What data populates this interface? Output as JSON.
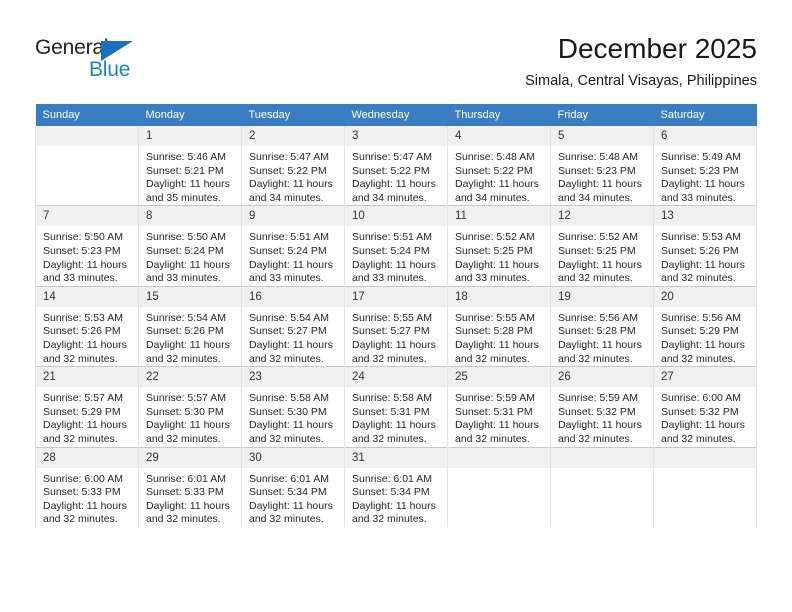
{
  "brand": {
    "name_top": "General",
    "name_bottom": "Blue",
    "accent_color": "#1c84d4",
    "triangle_color": "#1c6fba"
  },
  "header": {
    "title": "December 2025",
    "subtitle": "Simala, Central Visayas, Philippines"
  },
  "calendar": {
    "header_bg": "#3a7ec1",
    "daynum_bg": "#f0f0f0",
    "weekdays": [
      "Sunday",
      "Monday",
      "Tuesday",
      "Wednesday",
      "Thursday",
      "Friday",
      "Saturday"
    ],
    "weeks": [
      [
        {
          "day": "",
          "empty": true,
          "sunrise": "",
          "sunset": "",
          "daylight_line1": "",
          "daylight_line2": ""
        },
        {
          "day": "1",
          "sunrise": "Sunrise: 5:46 AM",
          "sunset": "Sunset: 5:21 PM",
          "daylight_line1": "Daylight: 11 hours",
          "daylight_line2": "and 35 minutes."
        },
        {
          "day": "2",
          "sunrise": "Sunrise: 5:47 AM",
          "sunset": "Sunset: 5:22 PM",
          "daylight_line1": "Daylight: 11 hours",
          "daylight_line2": "and 34 minutes."
        },
        {
          "day": "3",
          "sunrise": "Sunrise: 5:47 AM",
          "sunset": "Sunset: 5:22 PM",
          "daylight_line1": "Daylight: 11 hours",
          "daylight_line2": "and 34 minutes."
        },
        {
          "day": "4",
          "sunrise": "Sunrise: 5:48 AM",
          "sunset": "Sunset: 5:22 PM",
          "daylight_line1": "Daylight: 11 hours",
          "daylight_line2": "and 34 minutes."
        },
        {
          "day": "5",
          "sunrise": "Sunrise: 5:48 AM",
          "sunset": "Sunset: 5:23 PM",
          "daylight_line1": "Daylight: 11 hours",
          "daylight_line2": "and 34 minutes."
        },
        {
          "day": "6",
          "sunrise": "Sunrise: 5:49 AM",
          "sunset": "Sunset: 5:23 PM",
          "daylight_line1": "Daylight: 11 hours",
          "daylight_line2": "and 33 minutes."
        }
      ],
      [
        {
          "day": "7",
          "sunrise": "Sunrise: 5:50 AM",
          "sunset": "Sunset: 5:23 PM",
          "daylight_line1": "Daylight: 11 hours",
          "daylight_line2": "and 33 minutes."
        },
        {
          "day": "8",
          "sunrise": "Sunrise: 5:50 AM",
          "sunset": "Sunset: 5:24 PM",
          "daylight_line1": "Daylight: 11 hours",
          "daylight_line2": "and 33 minutes."
        },
        {
          "day": "9",
          "sunrise": "Sunrise: 5:51 AM",
          "sunset": "Sunset: 5:24 PM",
          "daylight_line1": "Daylight: 11 hours",
          "daylight_line2": "and 33 minutes."
        },
        {
          "day": "10",
          "sunrise": "Sunrise: 5:51 AM",
          "sunset": "Sunset: 5:24 PM",
          "daylight_line1": "Daylight: 11 hours",
          "daylight_line2": "and 33 minutes."
        },
        {
          "day": "11",
          "sunrise": "Sunrise: 5:52 AM",
          "sunset": "Sunset: 5:25 PM",
          "daylight_line1": "Daylight: 11 hours",
          "daylight_line2": "and 33 minutes."
        },
        {
          "day": "12",
          "sunrise": "Sunrise: 5:52 AM",
          "sunset": "Sunset: 5:25 PM",
          "daylight_line1": "Daylight: 11 hours",
          "daylight_line2": "and 32 minutes."
        },
        {
          "day": "13",
          "sunrise": "Sunrise: 5:53 AM",
          "sunset": "Sunset: 5:26 PM",
          "daylight_line1": "Daylight: 11 hours",
          "daylight_line2": "and 32 minutes."
        }
      ],
      [
        {
          "day": "14",
          "sunrise": "Sunrise: 5:53 AM",
          "sunset": "Sunset: 5:26 PM",
          "daylight_line1": "Daylight: 11 hours",
          "daylight_line2": "and 32 minutes."
        },
        {
          "day": "15",
          "sunrise": "Sunrise: 5:54 AM",
          "sunset": "Sunset: 5:26 PM",
          "daylight_line1": "Daylight: 11 hours",
          "daylight_line2": "and 32 minutes."
        },
        {
          "day": "16",
          "sunrise": "Sunrise: 5:54 AM",
          "sunset": "Sunset: 5:27 PM",
          "daylight_line1": "Daylight: 11 hours",
          "daylight_line2": "and 32 minutes."
        },
        {
          "day": "17",
          "sunrise": "Sunrise: 5:55 AM",
          "sunset": "Sunset: 5:27 PM",
          "daylight_line1": "Daylight: 11 hours",
          "daylight_line2": "and 32 minutes."
        },
        {
          "day": "18",
          "sunrise": "Sunrise: 5:55 AM",
          "sunset": "Sunset: 5:28 PM",
          "daylight_line1": "Daylight: 11 hours",
          "daylight_line2": "and 32 minutes."
        },
        {
          "day": "19",
          "sunrise": "Sunrise: 5:56 AM",
          "sunset": "Sunset: 5:28 PM",
          "daylight_line1": "Daylight: 11 hours",
          "daylight_line2": "and 32 minutes."
        },
        {
          "day": "20",
          "sunrise": "Sunrise: 5:56 AM",
          "sunset": "Sunset: 5:29 PM",
          "daylight_line1": "Daylight: 11 hours",
          "daylight_line2": "and 32 minutes."
        }
      ],
      [
        {
          "day": "21",
          "sunrise": "Sunrise: 5:57 AM",
          "sunset": "Sunset: 5:29 PM",
          "daylight_line1": "Daylight: 11 hours",
          "daylight_line2": "and 32 minutes."
        },
        {
          "day": "22",
          "sunrise": "Sunrise: 5:57 AM",
          "sunset": "Sunset: 5:30 PM",
          "daylight_line1": "Daylight: 11 hours",
          "daylight_line2": "and 32 minutes."
        },
        {
          "day": "23",
          "sunrise": "Sunrise: 5:58 AM",
          "sunset": "Sunset: 5:30 PM",
          "daylight_line1": "Daylight: 11 hours",
          "daylight_line2": "and 32 minutes."
        },
        {
          "day": "24",
          "sunrise": "Sunrise: 5:58 AM",
          "sunset": "Sunset: 5:31 PM",
          "daylight_line1": "Daylight: 11 hours",
          "daylight_line2": "and 32 minutes."
        },
        {
          "day": "25",
          "sunrise": "Sunrise: 5:59 AM",
          "sunset": "Sunset: 5:31 PM",
          "daylight_line1": "Daylight: 11 hours",
          "daylight_line2": "and 32 minutes."
        },
        {
          "day": "26",
          "sunrise": "Sunrise: 5:59 AM",
          "sunset": "Sunset: 5:32 PM",
          "daylight_line1": "Daylight: 11 hours",
          "daylight_line2": "and 32 minutes."
        },
        {
          "day": "27",
          "sunrise": "Sunrise: 6:00 AM",
          "sunset": "Sunset: 5:32 PM",
          "daylight_line1": "Daylight: 11 hours",
          "daylight_line2": "and 32 minutes."
        }
      ],
      [
        {
          "day": "28",
          "sunrise": "Sunrise: 6:00 AM",
          "sunset": "Sunset: 5:33 PM",
          "daylight_line1": "Daylight: 11 hours",
          "daylight_line2": "and 32 minutes."
        },
        {
          "day": "29",
          "sunrise": "Sunrise: 6:01 AM",
          "sunset": "Sunset: 5:33 PM",
          "daylight_line1": "Daylight: 11 hours",
          "daylight_line2": "and 32 minutes."
        },
        {
          "day": "30",
          "sunrise": "Sunrise: 6:01 AM",
          "sunset": "Sunset: 5:34 PM",
          "daylight_line1": "Daylight: 11 hours",
          "daylight_line2": "and 32 minutes."
        },
        {
          "day": "31",
          "sunrise": "Sunrise: 6:01 AM",
          "sunset": "Sunset: 5:34 PM",
          "daylight_line1": "Daylight: 11 hours",
          "daylight_line2": "and 32 minutes."
        },
        {
          "day": "",
          "empty": true,
          "sunrise": "",
          "sunset": "",
          "daylight_line1": "",
          "daylight_line2": ""
        },
        {
          "day": "",
          "empty": true,
          "sunrise": "",
          "sunset": "",
          "daylight_line1": "",
          "daylight_line2": ""
        },
        {
          "day": "",
          "empty": true,
          "sunrise": "",
          "sunset": "",
          "daylight_line1": "",
          "daylight_line2": ""
        }
      ]
    ]
  }
}
